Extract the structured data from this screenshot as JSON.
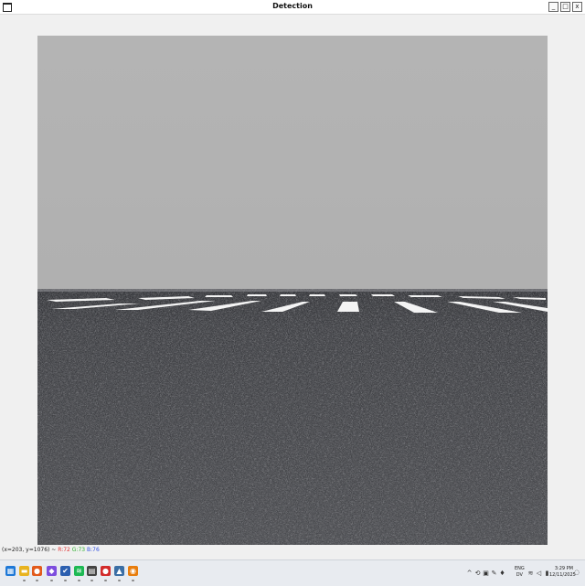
{
  "window": {
    "title": "Detection",
    "controls": {
      "minimize": "_",
      "maximize": "□",
      "close": "x"
    }
  },
  "canvas": {
    "scene": "runway-asphalt-with-threshold-markings",
    "sky_color": "#b3b3b3",
    "ground_color": "#3d3e42",
    "marking_color": "#ffffff"
  },
  "status": {
    "coords": "(x=203, y=1076) ~",
    "r": "R:72",
    "g": "G:73",
    "b": "B:76"
  },
  "taskbar": {
    "icons": [
      {
        "name": "windows-start-icon",
        "glyph": "▦",
        "color": "#1e78d7"
      },
      {
        "name": "file-explorer-icon",
        "glyph": "▬",
        "color": "#e8b320"
      },
      {
        "name": "firefox-icon",
        "glyph": "●",
        "color": "#e25a1c"
      },
      {
        "name": "app-purple-icon",
        "glyph": "◆",
        "color": "#7c4dde"
      },
      {
        "name": "checkmark-app-icon",
        "glyph": "✔",
        "color": "#2b5fb0"
      },
      {
        "name": "spotify-icon",
        "glyph": "≋",
        "color": "#1db954"
      },
      {
        "name": "terminal-icon",
        "glyph": "▤",
        "color": "#444444"
      },
      {
        "name": "record-app-icon",
        "glyph": "●",
        "color": "#d22b2b"
      },
      {
        "name": "python-app-icon",
        "glyph": "▲",
        "color": "#3a6ea5"
      },
      {
        "name": "blender-icon",
        "glyph": "◉",
        "color": "#e87d0d"
      }
    ],
    "tray": {
      "glyphs": [
        "^",
        "⟲",
        "▣",
        "✎",
        "♦"
      ],
      "lang_top": "ENG",
      "lang_bottom": "DV",
      "system": [
        "≋",
        "◁",
        "▮"
      ],
      "time": "3:29 PM",
      "date": "12/11/2025"
    }
  }
}
